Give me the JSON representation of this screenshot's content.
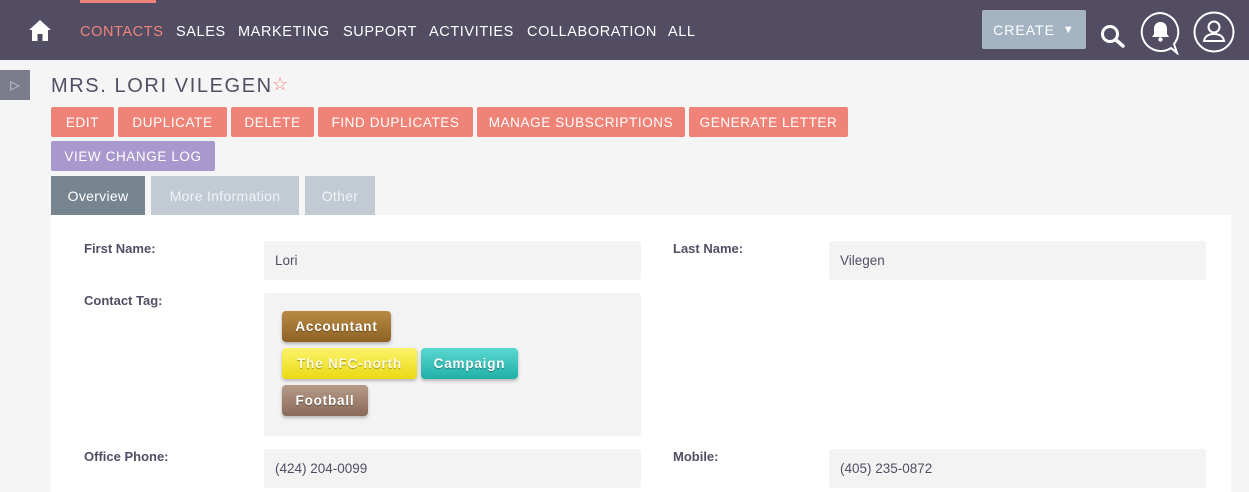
{
  "nav": {
    "items": [
      "CONTACTS",
      "SALES",
      "MARKETING",
      "SUPPORT",
      "ACTIVITIES",
      "COLLABORATION",
      "ALL"
    ],
    "active_index": 0,
    "create_label": "CREATE",
    "create_caret": "▼"
  },
  "sidebar": {
    "toggle_glyph": "▷"
  },
  "record": {
    "title": "MRS. LORI VILEGEN",
    "favorite_glyph": "☆"
  },
  "actions": {
    "edit": "EDIT",
    "duplicate": "DUPLICATE",
    "delete": "DELETE",
    "find_duplicates": "FIND DUPLICATES",
    "manage_subscriptions": "MANAGE SUBSCRIPTIONS",
    "generate_letter": "GENERATE LETTER",
    "view_change_log": "VIEW CHANGE LOG"
  },
  "tabs": [
    {
      "label": "Overview",
      "active": true
    },
    {
      "label": "More Information",
      "active": false
    },
    {
      "label": "Other",
      "active": false
    }
  ],
  "fields": {
    "first_name": {
      "label": "First Name:",
      "value": "Lori"
    },
    "last_name": {
      "label": "Last Name:",
      "value": "Vilegen"
    },
    "contact_tag": {
      "label": "Contact Tag:",
      "tags": [
        {
          "text": "Accountant",
          "color": "#9b6f2e"
        },
        {
          "text": "The NFC-north",
          "color": "#f2e42a"
        },
        {
          "text": "Campaign",
          "color": "#2bc0b8"
        },
        {
          "text": "Football",
          "color": "#9a7a68"
        }
      ]
    },
    "office_phone": {
      "label": "Office Phone:",
      "value": "(424) 204-0099"
    },
    "mobile": {
      "label": "Mobile:",
      "value": "(405) 235-0872"
    }
  },
  "colors": {
    "topbar": "#534d64",
    "accent": "#f08377",
    "secondary_button": "#a998ce",
    "tab_active": "#778591",
    "tab_inactive": "#c2cbd4"
  },
  "icons": {
    "home": "home-icon",
    "search": "search-icon",
    "notifications": "bell-icon",
    "user": "user-icon"
  }
}
